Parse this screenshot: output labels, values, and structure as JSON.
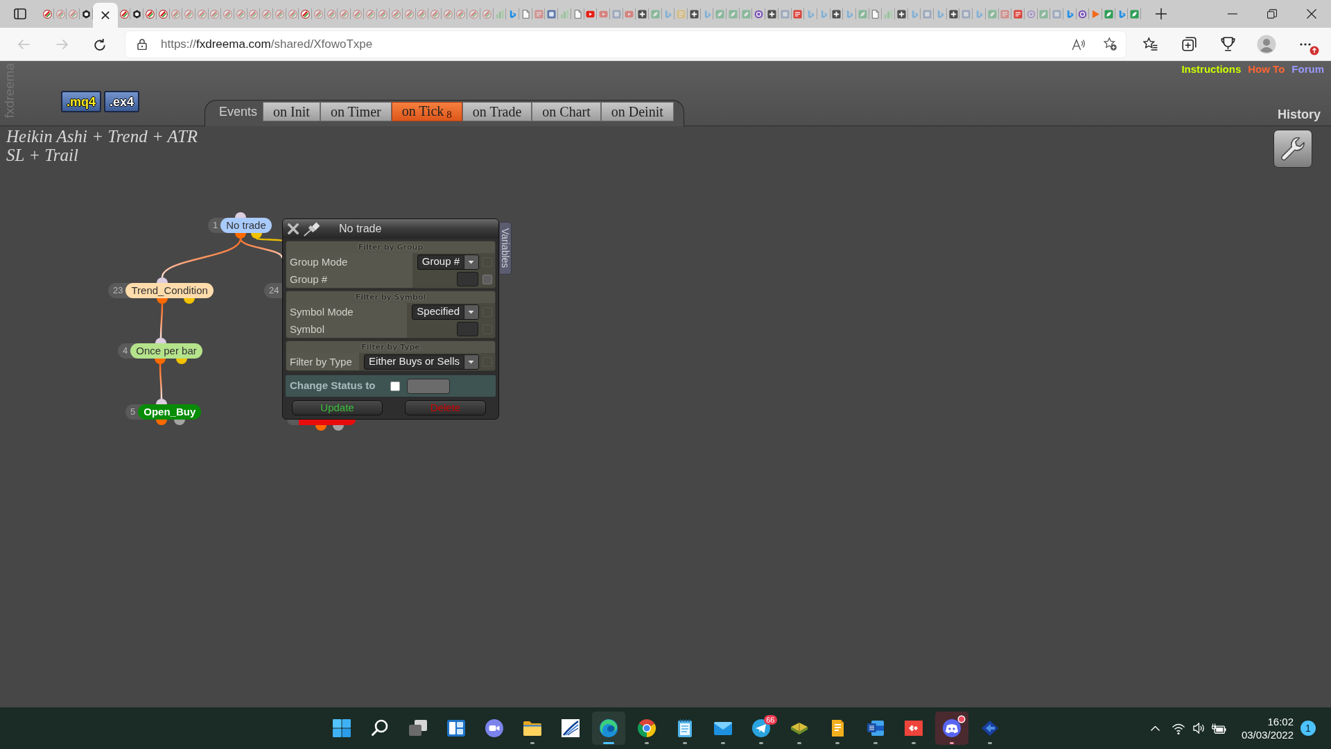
{
  "browser": {
    "tabs": [
      {
        "kind": "swirl",
        "selected": false,
        "sleeping": false
      },
      {
        "kind": "swirl",
        "selected": false,
        "sleeping": true
      },
      {
        "kind": "swirl",
        "selected": false,
        "sleeping": true
      },
      {
        "kind": "hexagon",
        "selected": false,
        "sleeping": false
      },
      {
        "selected": true
      },
      {
        "kind": "swirl",
        "selected": false,
        "sleeping": false
      },
      {
        "kind": "hexagon",
        "selected": false,
        "sleeping": false
      },
      {
        "kind": "swirl",
        "selected": false,
        "sleeping": false
      },
      {
        "kind": "swirl",
        "selected": false,
        "sleeping": false
      },
      {
        "kind": "swirl",
        "selected": false,
        "sleeping": true
      },
      {
        "kind": "swirl",
        "selected": false,
        "sleeping": true
      },
      {
        "kind": "swirl",
        "selected": false,
        "sleeping": true
      },
      {
        "kind": "swirl",
        "selected": false,
        "sleeping": true
      },
      {
        "kind": "swirl",
        "selected": false,
        "sleeping": true
      },
      {
        "kind": "swirl",
        "selected": false,
        "sleeping": true
      },
      {
        "kind": "swirl",
        "selected": false,
        "sleeping": true
      },
      {
        "kind": "swirl",
        "selected": false,
        "sleeping": true
      },
      {
        "kind": "swirl",
        "selected": false,
        "sleeping": true
      },
      {
        "kind": "swirl",
        "selected": false,
        "sleeping": true
      },
      {
        "kind": "swirl",
        "selected": false,
        "sleeping": false
      },
      {
        "kind": "swirl",
        "selected": false,
        "sleeping": true
      },
      {
        "kind": "swirl",
        "selected": false,
        "sleeping": true
      },
      {
        "kind": "swirl",
        "selected": false,
        "sleeping": true
      },
      {
        "kind": "swirl",
        "selected": false,
        "sleeping": true
      },
      {
        "kind": "swirl",
        "selected": false,
        "sleeping": true
      },
      {
        "kind": "swirl",
        "selected": false,
        "sleeping": true
      },
      {
        "kind": "swirl",
        "selected": false,
        "sleeping": true
      },
      {
        "kind": "swirl",
        "selected": false,
        "sleeping": true
      },
      {
        "kind": "swirl",
        "selected": false,
        "sleeping": true
      },
      {
        "kind": "swirl",
        "selected": false,
        "sleeping": true
      },
      {
        "kind": "swirl",
        "selected": false,
        "sleeping": true
      },
      {
        "kind": "swirl",
        "selected": false,
        "sleeping": true
      },
      {
        "kind": "swirl",
        "selected": false,
        "sleeping": true
      },
      {
        "kind": "swirl",
        "selected": false,
        "sleeping": true
      },
      {
        "kind": "bars",
        "selected": false,
        "sleeping": true
      },
      {
        "kind": "ribbon",
        "selected": false,
        "sleeping": false
      },
      {
        "kind": "page",
        "selected": false,
        "sleeping": false
      },
      {
        "kind": "stamp",
        "selected": false,
        "sleeping": true
      },
      {
        "kind": "tile",
        "selected": false,
        "sleeping": false
      },
      {
        "kind": "bars",
        "selected": false,
        "sleeping": true
      },
      {
        "kind": "page",
        "selected": false,
        "sleeping": false
      },
      {
        "kind": "video",
        "selected": false,
        "sleeping": false
      },
      {
        "kind": "video",
        "selected": false,
        "sleeping": true
      },
      {
        "kind": "tile",
        "selected": false,
        "sleeping": true
      },
      {
        "kind": "video",
        "selected": false,
        "sleeping": true
      },
      {
        "kind": "plus",
        "selected": false,
        "sleeping": false
      },
      {
        "kind": "leaf",
        "selected": false,
        "sleeping": true
      },
      {
        "kind": "ribbon",
        "selected": false,
        "sleeping": true
      },
      {
        "kind": "note",
        "selected": false,
        "sleeping": true
      },
      {
        "kind": "plus",
        "selected": false,
        "sleeping": false
      },
      {
        "kind": "ribbon",
        "selected": false,
        "sleeping": true
      },
      {
        "kind": "leaf",
        "selected": false,
        "sleeping": true
      },
      {
        "kind": "leaf",
        "selected": false,
        "sleeping": true
      },
      {
        "kind": "leaf",
        "selected": false,
        "sleeping": true
      },
      {
        "kind": "disc",
        "selected": false,
        "sleeping": false
      },
      {
        "kind": "plus",
        "selected": false,
        "sleeping": false
      },
      {
        "kind": "tile",
        "selected": false,
        "sleeping": true
      },
      {
        "kind": "stamp",
        "selected": false,
        "sleeping": false
      },
      {
        "kind": "ribbon",
        "selected": false,
        "sleeping": true
      },
      {
        "kind": "ribbon",
        "selected": false,
        "sleeping": true
      },
      {
        "kind": "plus",
        "selected": false,
        "sleeping": false
      },
      {
        "kind": "ribbon",
        "selected": false,
        "sleeping": true
      },
      {
        "kind": "leaf",
        "selected": false,
        "sleeping": true
      },
      {
        "kind": "page",
        "selected": false,
        "sleeping": false
      },
      {
        "kind": "bars",
        "selected": false,
        "sleeping": true
      },
      {
        "kind": "plus",
        "selected": false,
        "sleeping": false
      },
      {
        "kind": "ribbon",
        "selected": false,
        "sleeping": true
      },
      {
        "kind": "tile",
        "selected": false,
        "sleeping": true
      },
      {
        "kind": "ribbon",
        "selected": false,
        "sleeping": true
      },
      {
        "kind": "plus",
        "selected": false,
        "sleeping": false
      },
      {
        "kind": "tile",
        "selected": false,
        "sleeping": true
      },
      {
        "kind": "ribbon",
        "selected": false,
        "sleeping": true
      },
      {
        "kind": "leaf",
        "selected": false,
        "sleeping": true
      },
      {
        "kind": "stamp",
        "selected": false,
        "sleeping": true
      },
      {
        "kind": "stamp",
        "selected": false,
        "sleeping": false
      },
      {
        "kind": "disc",
        "selected": false,
        "sleeping": true
      },
      {
        "kind": "leaf",
        "selected": false,
        "sleeping": true
      },
      {
        "kind": "tile",
        "selected": false,
        "sleeping": true
      },
      {
        "kind": "ribbon",
        "selected": false,
        "sleeping": false
      },
      {
        "kind": "disc",
        "selected": false,
        "sleeping": false
      },
      {
        "kind": "play",
        "selected": false,
        "sleeping": false
      },
      {
        "kind": "leaf",
        "selected": false,
        "sleeping": false
      },
      {
        "kind": "ribbon",
        "selected": false,
        "sleeping": false
      },
      {
        "kind": "leaf",
        "selected": false,
        "sleeping": false
      }
    ],
    "back": {
      "disabled": true
    },
    "forward": {
      "disabled": true
    },
    "address": {
      "scheme": "https://",
      "host": "fxdreema.com",
      "path": "/shared/XfowoTxpe"
    },
    "update_alert": true
  },
  "app": {
    "logo": "fxdreema",
    "export_buttons": [
      {
        "label": ".mq4",
        "color": "#ffee22"
      },
      {
        "label": ".ex4",
        "color": "#ffffff"
      }
    ],
    "events_label": "Events",
    "event_tabs": [
      {
        "label": "on Init",
        "selected": false
      },
      {
        "label": "on Timer",
        "selected": false
      },
      {
        "label": "on Tick",
        "count": "8",
        "selected": true
      },
      {
        "label": "on Trade",
        "selected": false
      },
      {
        "label": "on Chart",
        "selected": false
      },
      {
        "label": "on Deinit",
        "selected": false
      }
    ],
    "top_links": [
      {
        "label": "Instructions",
        "color": "#ccff00"
      },
      {
        "label": "How To",
        "color": "#ff6633"
      },
      {
        "label": "Forum",
        "color": "#9999ff"
      }
    ],
    "history_label": "History",
    "project_title": "Heikin Ashi + Trend + ATR SL + Trail"
  },
  "canvas": {
    "nodes": [
      {
        "number": "1",
        "label": "No trade",
        "kind": "condition",
        "color": "#a9cbfb",
        "children": [
          {
            "number": "23",
            "label": "Trend_Condition",
            "kind": "condition",
            "color": "#ffdcab",
            "else_branch": false,
            "children": [
              {
                "number": "4",
                "label": "Once per bar",
                "kind": "condition",
                "color": "#b5e38b",
                "else_branch": false,
                "children": [
                  {
                    "number": "5",
                    "label": "Open_Buy",
                    "kind": "action",
                    "color": "#088c08",
                    "else_branch": false
                  }
                ]
              }
            ]
          },
          {
            "number": "24",
            "else_branch": false
          },
          {
            "else_branch": true
          }
        ]
      },
      {
        "kind": "action",
        "color": "#e80c0c"
      }
    ]
  },
  "dialog": {
    "title": "No trade",
    "side_tab": "Variables",
    "sections": [
      {
        "title": "Filter by Group",
        "rows": [
          {
            "label": "Group Mode",
            "kind": "select",
            "value": "Group #",
            "toggle": {
              "checked": false,
              "disabled": true
            }
          },
          {
            "label": "Group #",
            "kind": "input",
            "toggle": {
              "checked": false,
              "disabled": false
            }
          }
        ]
      },
      {
        "title": "Filter by Symbol",
        "rows": [
          {
            "label": "Symbol Mode",
            "kind": "select",
            "value": "Specified",
            "toggle": {
              "checked": false,
              "disabled": true
            }
          },
          {
            "label": "Symbol",
            "kind": "input",
            "toggle": {
              "checked": false,
              "disabled": true
            }
          }
        ]
      },
      {
        "title": "Filter by Type",
        "rows": [
          {
            "label": "Filter by Type",
            "kind": "select",
            "value": "Either Buys or Sells",
            "toggle": {
              "checked": false,
              "disabled": true
            }
          }
        ]
      }
    ],
    "status_row": {
      "label": "Change Status to",
      "checked": false,
      "field_disabled": true
    },
    "buttons": [
      {
        "label": "Update",
        "kind": "update"
      },
      {
        "label": "Delete",
        "kind": "delete"
      }
    ]
  },
  "taskbar": {
    "items": [
      {
        "kind": "start",
        "running": false,
        "selected": false,
        "alert": false
      },
      {
        "kind": "search",
        "running": false,
        "selected": false,
        "alert": false
      },
      {
        "kind": "taskview",
        "running": false,
        "selected": false,
        "alert": false
      },
      {
        "kind": "widgets",
        "running": false,
        "selected": false,
        "alert": false
      },
      {
        "kind": "chat",
        "running": false,
        "selected": false,
        "alert": false
      },
      {
        "kind": "folder",
        "running": true,
        "selected": false,
        "alert": false
      },
      {
        "kind": "swoosh",
        "running": false,
        "selected": false,
        "alert": false
      },
      {
        "kind": "edge",
        "running": true,
        "selected": true,
        "alert": false
      },
      {
        "kind": "chrome",
        "running": true,
        "selected": false,
        "alert": false
      },
      {
        "kind": "notepad",
        "running": true,
        "selected": false,
        "alert": false
      },
      {
        "kind": "mail",
        "running": true,
        "selected": false,
        "alert": false
      },
      {
        "kind": "telegram",
        "running": true,
        "selected": false,
        "alert": false,
        "badge": "66"
      },
      {
        "kind": "book",
        "running": true,
        "selected": false,
        "alert": false
      },
      {
        "kind": "sheet",
        "running": true,
        "selected": false,
        "alert": false
      },
      {
        "kind": "word",
        "running": true,
        "selected": false,
        "alert": false
      },
      {
        "kind": "remote",
        "running": true,
        "selected": false,
        "alert": false
      },
      {
        "kind": "discord",
        "running": true,
        "selected": false,
        "alert": true
      },
      {
        "kind": "arrow",
        "running": true,
        "selected": false,
        "alert": false
      }
    ],
    "tray": {
      "time": "16:02",
      "date": "03/03/2022",
      "notifications": "1"
    }
  }
}
